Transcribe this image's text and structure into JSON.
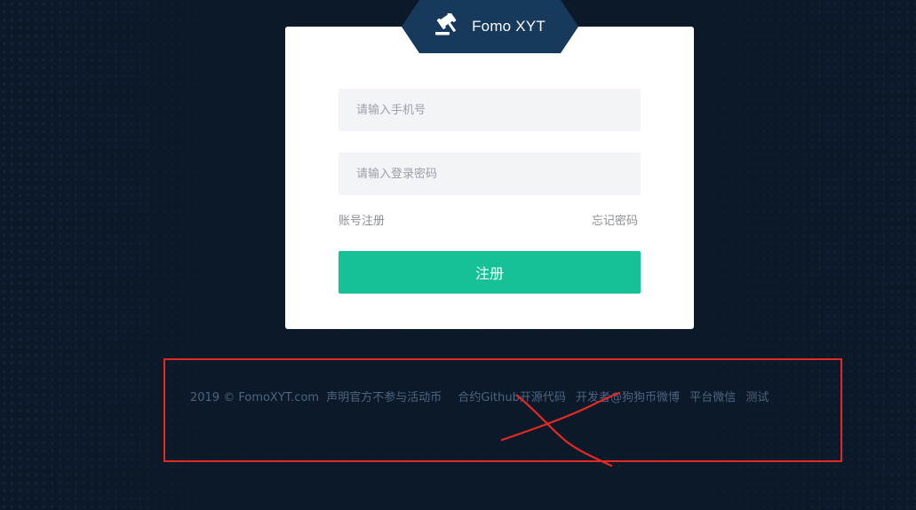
{
  "brand": {
    "name": "Fomo XYT",
    "icon": "gavel-icon",
    "tab_color": "#173a5c"
  },
  "form": {
    "phone_placeholder": "请输入手机号",
    "password_placeholder": "请输入登录密码",
    "register_link": "账号注册",
    "forgot_link": "忘记密码",
    "submit_label": "注册"
  },
  "footer": {
    "copyright": "2019 © FomoXYT.com",
    "links": [
      "声明官方不参与活动币",
      "合约Github开源代码",
      "开发者@狗狗币微博",
      "平台微信",
      "测试"
    ]
  },
  "colors": {
    "background": "#0b1929",
    "accent": "#17c197",
    "annotation": "#e32a22"
  }
}
